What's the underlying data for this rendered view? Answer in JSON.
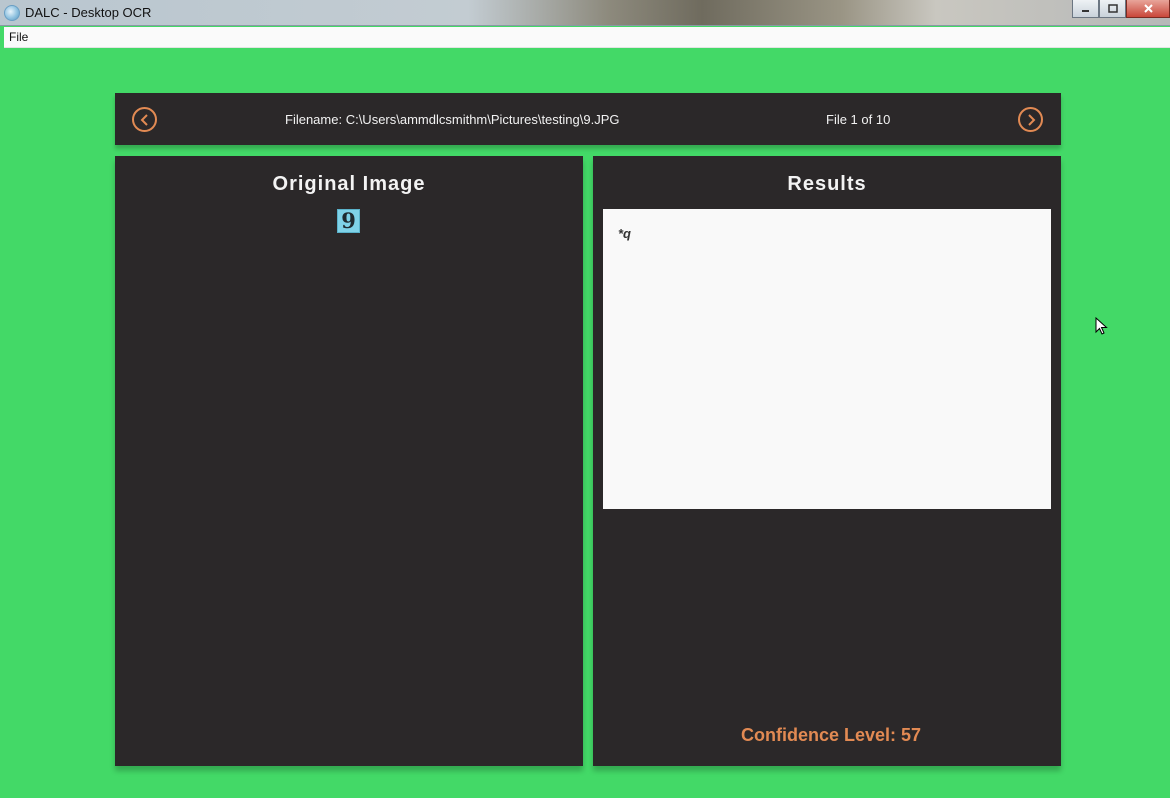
{
  "window": {
    "title": "DALC - Desktop OCR",
    "icon": "app-icon",
    "controls": [
      "minimize",
      "maximize",
      "close"
    ]
  },
  "menu": {
    "items": [
      {
        "label": "File"
      }
    ]
  },
  "navigation": {
    "prev_icon": "chevron-left-icon",
    "next_icon": "chevron-right-icon",
    "filename": "Filename: C:\\Users\\ammdlcsmithm\\Pictures\\testing\\9.JPG",
    "file_counter": "File 1 of 10"
  },
  "original_panel": {
    "title": "Original Image",
    "thumbnail_glyph": "9"
  },
  "results_panel": {
    "title": "Results",
    "result_text": "*q",
    "confidence_label": "Confidence Level:",
    "confidence_value": "57"
  },
  "colors": {
    "background": "#43d967",
    "panel": "#2b2829",
    "accent": "#e28a53",
    "results_bg": "#f9f9f9"
  }
}
